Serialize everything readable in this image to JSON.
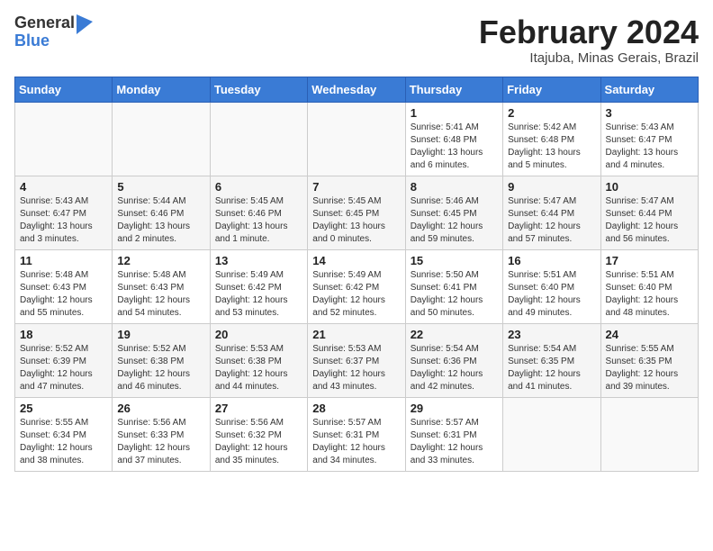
{
  "header": {
    "logo_general": "General",
    "logo_blue": "Blue",
    "month_year": "February 2024",
    "location": "Itajuba, Minas Gerais, Brazil"
  },
  "weekdays": [
    "Sunday",
    "Monday",
    "Tuesday",
    "Wednesday",
    "Thursday",
    "Friday",
    "Saturday"
  ],
  "weeks": [
    [
      {
        "day": "",
        "info": ""
      },
      {
        "day": "",
        "info": ""
      },
      {
        "day": "",
        "info": ""
      },
      {
        "day": "",
        "info": ""
      },
      {
        "day": "1",
        "info": "Sunrise: 5:41 AM\nSunset: 6:48 PM\nDaylight: 13 hours\nand 6 minutes."
      },
      {
        "day": "2",
        "info": "Sunrise: 5:42 AM\nSunset: 6:48 PM\nDaylight: 13 hours\nand 5 minutes."
      },
      {
        "day": "3",
        "info": "Sunrise: 5:43 AM\nSunset: 6:47 PM\nDaylight: 13 hours\nand 4 minutes."
      }
    ],
    [
      {
        "day": "4",
        "info": "Sunrise: 5:43 AM\nSunset: 6:47 PM\nDaylight: 13 hours\nand 3 minutes."
      },
      {
        "day": "5",
        "info": "Sunrise: 5:44 AM\nSunset: 6:46 PM\nDaylight: 13 hours\nand 2 minutes."
      },
      {
        "day": "6",
        "info": "Sunrise: 5:45 AM\nSunset: 6:46 PM\nDaylight: 13 hours\nand 1 minute."
      },
      {
        "day": "7",
        "info": "Sunrise: 5:45 AM\nSunset: 6:45 PM\nDaylight: 13 hours\nand 0 minutes."
      },
      {
        "day": "8",
        "info": "Sunrise: 5:46 AM\nSunset: 6:45 PM\nDaylight: 12 hours\nand 59 minutes."
      },
      {
        "day": "9",
        "info": "Sunrise: 5:47 AM\nSunset: 6:44 PM\nDaylight: 12 hours\nand 57 minutes."
      },
      {
        "day": "10",
        "info": "Sunrise: 5:47 AM\nSunset: 6:44 PM\nDaylight: 12 hours\nand 56 minutes."
      }
    ],
    [
      {
        "day": "11",
        "info": "Sunrise: 5:48 AM\nSunset: 6:43 PM\nDaylight: 12 hours\nand 55 minutes."
      },
      {
        "day": "12",
        "info": "Sunrise: 5:48 AM\nSunset: 6:43 PM\nDaylight: 12 hours\nand 54 minutes."
      },
      {
        "day": "13",
        "info": "Sunrise: 5:49 AM\nSunset: 6:42 PM\nDaylight: 12 hours\nand 53 minutes."
      },
      {
        "day": "14",
        "info": "Sunrise: 5:49 AM\nSunset: 6:42 PM\nDaylight: 12 hours\nand 52 minutes."
      },
      {
        "day": "15",
        "info": "Sunrise: 5:50 AM\nSunset: 6:41 PM\nDaylight: 12 hours\nand 50 minutes."
      },
      {
        "day": "16",
        "info": "Sunrise: 5:51 AM\nSunset: 6:40 PM\nDaylight: 12 hours\nand 49 minutes."
      },
      {
        "day": "17",
        "info": "Sunrise: 5:51 AM\nSunset: 6:40 PM\nDaylight: 12 hours\nand 48 minutes."
      }
    ],
    [
      {
        "day": "18",
        "info": "Sunrise: 5:52 AM\nSunset: 6:39 PM\nDaylight: 12 hours\nand 47 minutes."
      },
      {
        "day": "19",
        "info": "Sunrise: 5:52 AM\nSunset: 6:38 PM\nDaylight: 12 hours\nand 46 minutes."
      },
      {
        "day": "20",
        "info": "Sunrise: 5:53 AM\nSunset: 6:38 PM\nDaylight: 12 hours\nand 44 minutes."
      },
      {
        "day": "21",
        "info": "Sunrise: 5:53 AM\nSunset: 6:37 PM\nDaylight: 12 hours\nand 43 minutes."
      },
      {
        "day": "22",
        "info": "Sunrise: 5:54 AM\nSunset: 6:36 PM\nDaylight: 12 hours\nand 42 minutes."
      },
      {
        "day": "23",
        "info": "Sunrise: 5:54 AM\nSunset: 6:35 PM\nDaylight: 12 hours\nand 41 minutes."
      },
      {
        "day": "24",
        "info": "Sunrise: 5:55 AM\nSunset: 6:35 PM\nDaylight: 12 hours\nand 39 minutes."
      }
    ],
    [
      {
        "day": "25",
        "info": "Sunrise: 5:55 AM\nSunset: 6:34 PM\nDaylight: 12 hours\nand 38 minutes."
      },
      {
        "day": "26",
        "info": "Sunrise: 5:56 AM\nSunset: 6:33 PM\nDaylight: 12 hours\nand 37 minutes."
      },
      {
        "day": "27",
        "info": "Sunrise: 5:56 AM\nSunset: 6:32 PM\nDaylight: 12 hours\nand 35 minutes."
      },
      {
        "day": "28",
        "info": "Sunrise: 5:57 AM\nSunset: 6:31 PM\nDaylight: 12 hours\nand 34 minutes."
      },
      {
        "day": "29",
        "info": "Sunrise: 5:57 AM\nSunset: 6:31 PM\nDaylight: 12 hours\nand 33 minutes."
      },
      {
        "day": "",
        "info": ""
      },
      {
        "day": "",
        "info": ""
      }
    ]
  ]
}
